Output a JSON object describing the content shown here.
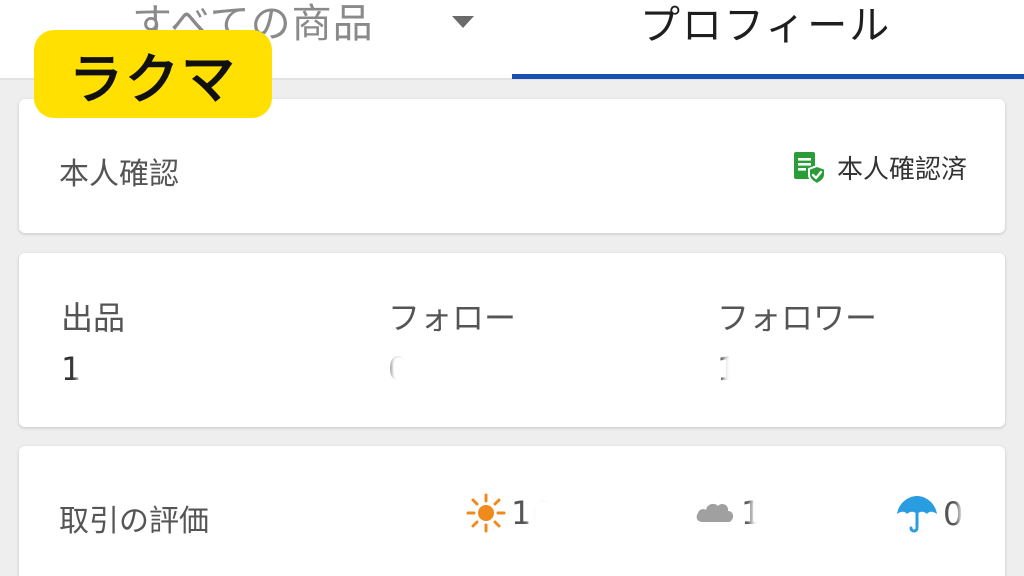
{
  "logo": {
    "text": "ラクマ",
    "color": "#ffe000"
  },
  "tabs": [
    {
      "label": "すべての商品",
      "has_dropdown": true,
      "active": false
    },
    {
      "label": "プロフィール",
      "active": true
    }
  ],
  "accent_color": "#1a4fb3",
  "verification": {
    "label": "本人確認",
    "status": "本人確認済",
    "icon": "verified-document-icon",
    "icon_color": "#2a9d38"
  },
  "stats": [
    {
      "label": "出品",
      "value": "1"
    },
    {
      "label": "フォロー",
      "value": "0"
    },
    {
      "label": "フォロワー",
      "value": "1"
    }
  ],
  "rating": {
    "label": "取引の評価",
    "items": [
      {
        "icon": "sun-icon",
        "value": "16",
        "color": "#f08a1c"
      },
      {
        "icon": "cloud-icon",
        "value": "1",
        "color": "#9a9a9a"
      },
      {
        "icon": "umbrella-icon",
        "value": "0",
        "color": "#2a9de0"
      }
    ]
  }
}
